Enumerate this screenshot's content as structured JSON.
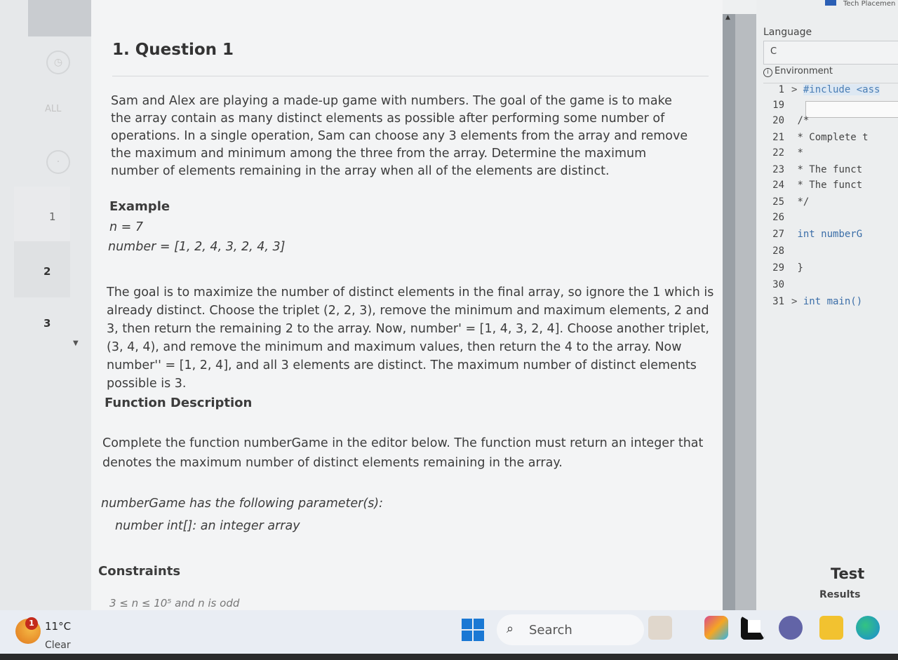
{
  "sidebar": {
    "all_label": "ALL",
    "questions": [
      "1",
      "2",
      "3"
    ]
  },
  "question": {
    "title": "1. Question 1",
    "intro": "Sam and Alex are playing a made-up game with numbers. The goal of the game is to make the array contain as many distinct elements as possible after performing some number of operations. In a single operation, Sam can choose any 3 elements from the array and remove the maximum and minimum among the three from the array.  Determine the maximum number of elements remaining in the array when all of the elements are distinct.",
    "example_heading": "Example",
    "example_n": "n = 7",
    "example_number": "number = [1, 2, 4, 3, 2, 4, 3]",
    "explanation": "The goal is to maximize the number of distinct elements in the final array, so ignore the 1 which is already distinct. Choose the triplet (2, 2, 3), remove the minimum and maximum elements, 2 and 3, then return the remaining 2 to the array. Now, number' = [1, 4, 3, 2, 4]. Choose another triplet, (3, 4, 4), and remove the minimum and maximum values, then return the 4 to the array. Now number'' = [1, 2, 4], and all 3 elements are distinct. The maximum number of distinct elements possible is 3.",
    "function_description_heading": "Function Description",
    "function_description": "Complete the function numberGame in the editor below. The function must return an integer that denotes the maximum number of distinct elements remaining in the array.",
    "params_heading": "numberGame has the following parameter(s):",
    "params_item": "number int[]: an integer array",
    "constraints_heading": "Constraints",
    "constraints_item": "3 ≤ n ≤ 10⁵  and n is odd"
  },
  "editor": {
    "header_text": "Tech Placemen",
    "language_label": "Language",
    "language_value": "C",
    "environment_label": "Environment",
    "code_lines": [
      {
        "ln": "1",
        "text": "#include <ass",
        "chev": true,
        "type": "inc"
      },
      {
        "ln": "19",
        "text": "",
        "chev": false,
        "type": "txt"
      },
      {
        "ln": "20",
        "text": "/*",
        "chev": false,
        "type": "txt"
      },
      {
        "ln": "21",
        "text": " * Complete t",
        "chev": false,
        "type": "txt"
      },
      {
        "ln": "22",
        "text": " *",
        "chev": false,
        "type": "txt"
      },
      {
        "ln": "23",
        "text": " * The funct",
        "chev": false,
        "type": "txt"
      },
      {
        "ln": "24",
        "text": " * The funct",
        "chev": false,
        "type": "txt"
      },
      {
        "ln": "25",
        "text": " */",
        "chev": false,
        "type": "txt"
      },
      {
        "ln": "26",
        "text": "",
        "chev": false,
        "type": "txt"
      },
      {
        "ln": "27",
        "text": "int numberG",
        "chev": false,
        "type": "kw"
      },
      {
        "ln": "28",
        "text": "",
        "chev": false,
        "type": "txt"
      },
      {
        "ln": "29",
        "text": "}",
        "chev": false,
        "type": "txt"
      },
      {
        "ln": "30",
        "text": "",
        "chev": false,
        "type": "txt"
      },
      {
        "ln": "31",
        "text": "int main()",
        "chev": true,
        "type": "kw"
      }
    ],
    "test_label": "Test",
    "results_label": "Results"
  },
  "taskbar": {
    "weather_badge": "1",
    "temperature": "11°C",
    "condition": "Clear",
    "search_placeholder": "Search",
    "colors": {
      "windows_blue": "#1a78d4",
      "badge_red": "#c42b1c"
    }
  }
}
